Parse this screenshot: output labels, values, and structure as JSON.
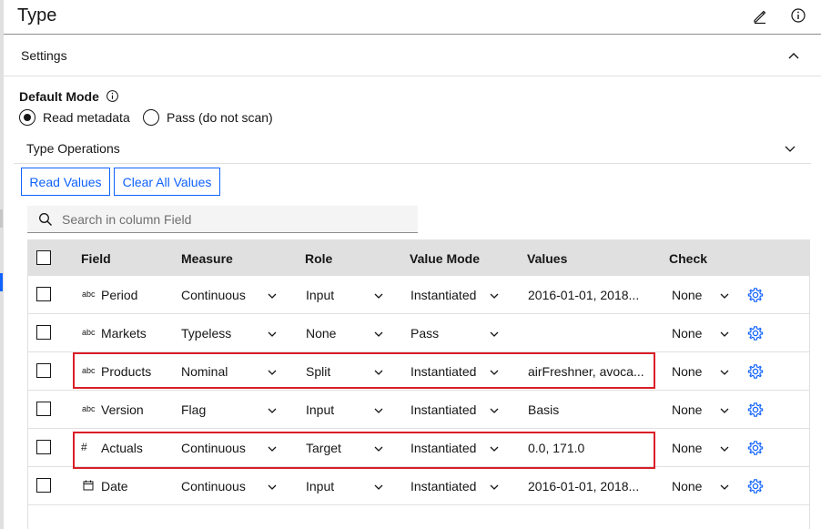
{
  "header": {
    "title": "Type",
    "edit_icon": "pencil-icon",
    "info_icon": "info-icon"
  },
  "settings": {
    "label": "Settings",
    "icon": "chevron-up-icon"
  },
  "default_mode": {
    "label": "Default Mode",
    "info_icon": "info-icon",
    "options": [
      {
        "label": "Read metadata",
        "selected": true
      },
      {
        "label": "Pass (do not scan)",
        "selected": false
      }
    ]
  },
  "type_operations": {
    "label": "Type Operations",
    "icon": "chevron-down-icon"
  },
  "buttons": {
    "read_values": "Read Values",
    "clear_all_values": "Clear All Values"
  },
  "search": {
    "placeholder": "Search in column Field",
    "value": ""
  },
  "table": {
    "headers": [
      "Field",
      "Measure",
      "Role",
      "Value Mode",
      "Values",
      "Check"
    ],
    "rows": [
      {
        "icon": "abc",
        "field": "Period",
        "measure": "Continuous",
        "role": "Input",
        "value_mode": "Instantiated",
        "values": "2016-01-01, 2018...",
        "check": "None"
      },
      {
        "icon": "abc",
        "field": "Markets",
        "measure": "Typeless",
        "role": "None",
        "value_mode": "Pass",
        "values": "",
        "check": "None"
      },
      {
        "icon": "abc",
        "field": "Products",
        "measure": "Nominal",
        "role": "Split",
        "value_mode": "Instantiated",
        "values": "airFreshner, avoca...",
        "check": "None"
      },
      {
        "icon": "abc",
        "field": "Version",
        "measure": "Flag",
        "role": "Input",
        "value_mode": "Instantiated",
        "values": "Basis",
        "check": "None"
      },
      {
        "icon": "number",
        "field": "Actuals",
        "measure": "Continuous",
        "role": "Target",
        "value_mode": "Instantiated",
        "values": "0.0, 171.0",
        "check": "None"
      },
      {
        "icon": "calendar",
        "field": "Date",
        "measure": "Continuous",
        "role": "Input",
        "value_mode": "Instantiated",
        "values": "2016-01-01, 2018...",
        "check": "None"
      }
    ]
  },
  "colors": {
    "accent": "#0f62fe",
    "highlight": "#da1e28",
    "header_bg": "#e0e0e0"
  }
}
